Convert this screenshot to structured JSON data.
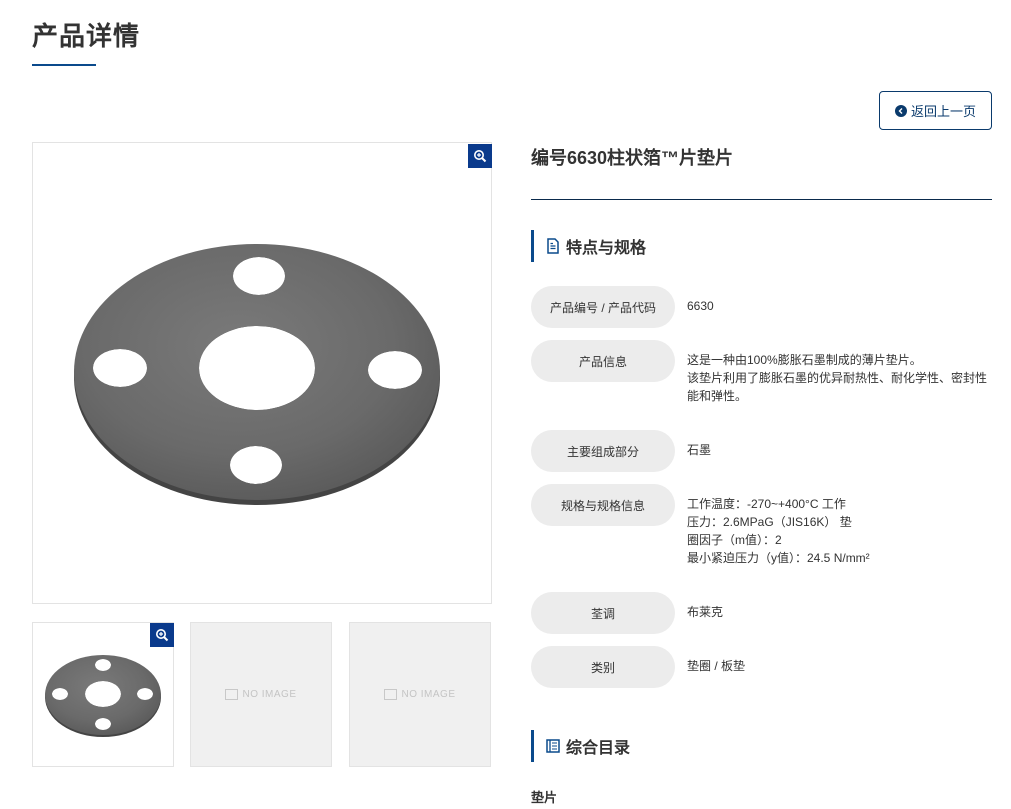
{
  "page": {
    "title": "产品详情"
  },
  "nav": {
    "back_label": "返回上一页"
  },
  "product": {
    "title": "编号6630柱状箔™片垫片"
  },
  "gallery": {
    "no_image_label": "NO IMAGE"
  },
  "specs": {
    "heading": "特点与规格",
    "rows": [
      {
        "label": "产品编号 / 产品代码",
        "lines": [
          "6630"
        ]
      },
      {
        "label": "产品信息",
        "lines": [
          "这是一种由100%膨胀石墨制成的薄片垫片。",
          "该垫片利用了膨胀石墨的优异耐热性、耐化学性、密封性",
          "能和弹性。"
        ]
      },
      {
        "label": "主要组成部分",
        "lines": [
          "石墨"
        ]
      },
      {
        "label": "规格与规格信息",
        "lines": [
          "工作温度：-270~+400°C 工作",
          "压力：2.6MPaG（JIS16K） 垫",
          "圈因子（m值）：2",
          "最小紧迫压力（y值）：24.5 N/mm²"
        ]
      },
      {
        "label": "荃调",
        "lines": [
          "布莱克"
        ]
      },
      {
        "label": "类别",
        "lines": [
          "垫圈 / 板垫"
        ]
      }
    ]
  },
  "catalog": {
    "heading": "综合目录",
    "items": [
      "垫片"
    ]
  },
  "colors": {
    "accent": "#0a4a8c",
    "zoom_bg": "#0a3a8c",
    "label_bg": "#ececec"
  }
}
